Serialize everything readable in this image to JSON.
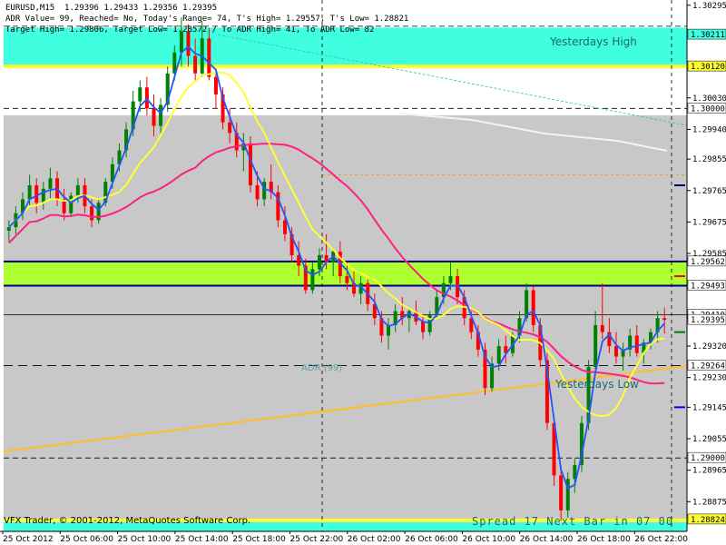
{
  "header": {
    "symbol_line": "EURUSD,M15  1.29396 1.29433 1.29356 1.29395",
    "adr_line": "ADR Value= 99, Reached= No, Today's Range= 74, T's High= 1.29557, T's Low= 1.28821",
    "target_line": "Target High= 1.29806, Target Low= 1.28572 / To ADR High= 41, To ADR Low= 82"
  },
  "footer": {
    "copyright": "VFX Trader, © 2001-2012, MetaQuotes Software Corp.",
    "spread": "Spread  17  Next Bar in 07 00"
  },
  "labels": {
    "yesterdays_high": "Yesterdays High",
    "yesterdays_low": "Yesterdays Low",
    "adr": "ADR (99)"
  },
  "colors": {
    "background": "#ffffff",
    "gray_zone": "#c8c8c8",
    "cyan_zone": "#40ffe0",
    "lime_zone": "#adff2f",
    "bull_candle": "#008000",
    "bear_candle": "#ff0000",
    "ma_blue": "#2255ff",
    "ma_yellow": "#ffff33",
    "ma_magenta": "#ff2080",
    "trend_orange": "#ffc020",
    "navy": "#000080"
  },
  "chart_data": {
    "type": "candlestick",
    "symbol": "EURUSD",
    "timeframe": "M15",
    "ylim": [
      1.2879,
      1.3031
    ],
    "x_ticks": [
      "25 Oct 2012",
      "25 Oct 06:00",
      "25 Oct 10:00",
      "25 Oct 14:00",
      "25 Oct 18:00",
      "25 Oct 22:00",
      "26 Oct 02:00",
      "26 Oct 06:00",
      "26 Oct 10:00",
      "26 Oct 14:00",
      "26 Oct 18:00",
      "26 Oct 22:00"
    ],
    "y_ticks": [
      1.30295,
      1.3003,
      1.2994,
      1.29855,
      1.29765,
      1.29675,
      1.29585,
      1.2932,
      1.2923,
      1.29145,
      1.29055,
      1.28965,
      1.28875
    ],
    "price_tags": [
      {
        "value": "1.30211",
        "level": 1.30211,
        "color": "#40ffe0"
      },
      {
        "value": "1.30120",
        "level": 1.3012,
        "color": "#ffff33"
      },
      {
        "value": "1.30000",
        "level": 1.3,
        "color": "#ffffff"
      },
      {
        "value": "1.29562",
        "level": 1.29562,
        "color": "#ffffff"
      },
      {
        "value": "1.29493",
        "level": 1.29493,
        "color": "#ffffff"
      },
      {
        "value": "1.29410",
        "level": 1.2941,
        "color": "#ffffff"
      },
      {
        "value": "1.29395",
        "level": 1.29395,
        "color": "#ffffff"
      },
      {
        "value": "1.29264",
        "level": 1.29264,
        "color": "#ffffff"
      },
      {
        "value": "1.29000",
        "level": 1.29,
        "color": "#ffffff"
      },
      {
        "value": "1.28824",
        "level": 1.28824,
        "color": "#ffff33"
      }
    ],
    "zones": {
      "cyan": [
        1.3012,
        1.30231
      ],
      "gray": [
        1.28824,
        1.2998
      ],
      "lime": [
        1.29493,
        1.29562
      ]
    },
    "ohlc_approx": [
      [
        1.2965,
        1.2968,
        1.2962,
        1.2966
      ],
      [
        1.2966,
        1.2972,
        1.2964,
        1.297
      ],
      [
        1.297,
        1.2976,
        1.2968,
        1.2974
      ],
      [
        1.2974,
        1.2981,
        1.2972,
        1.2978
      ],
      [
        1.2978,
        1.298,
        1.297,
        1.2973
      ],
      [
        1.2973,
        1.2979,
        1.2971,
        1.2977
      ],
      [
        1.2977,
        1.2983,
        1.2974,
        1.298
      ],
      [
        1.298,
        1.2982,
        1.2972,
        1.2974
      ],
      [
        1.2974,
        1.2977,
        1.2968,
        1.297
      ],
      [
        1.297,
        1.2976,
        1.2969,
        1.2975
      ],
      [
        1.2975,
        1.298,
        1.2973,
        1.2978
      ],
      [
        1.2978,
        1.298,
        1.297,
        1.2972
      ],
      [
        1.2972,
        1.2974,
        1.2966,
        1.2968
      ],
      [
        1.2968,
        1.2974,
        1.2967,
        1.2973
      ],
      [
        1.2973,
        1.298,
        1.2972,
        1.2979
      ],
      [
        1.2979,
        1.2986,
        1.2977,
        1.2984
      ],
      [
        1.2984,
        1.299,
        1.2982,
        1.2988
      ],
      [
        1.2988,
        1.2996,
        1.2986,
        1.2994
      ],
      [
        1.2994,
        1.3005,
        1.2992,
        1.3002
      ],
      [
        1.3002,
        1.3008,
        1.2999,
        1.3006
      ],
      [
        1.3006,
        1.3009,
        1.2998,
        1.3
      ],
      [
        1.3,
        1.3004,
        1.2992,
        1.2995
      ],
      [
        1.2995,
        1.3003,
        1.2993,
        1.3001
      ],
      [
        1.3001,
        1.3012,
        1.2999,
        1.301
      ],
      [
        1.301,
        1.3018,
        1.3008,
        1.3016
      ],
      [
        1.3016,
        1.3026,
        1.3012,
        1.3022
      ],
      [
        1.3022,
        1.3024,
        1.3012,
        1.3015
      ],
      [
        1.3015,
        1.302,
        1.3008,
        1.301
      ],
      [
        1.301,
        1.3025,
        1.3009,
        1.302
      ],
      [
        1.302,
        1.3023,
        1.3008,
        1.3009
      ],
      [
        1.3009,
        1.3011,
        1.3,
        1.3004
      ],
      [
        1.3004,
        1.3006,
        1.2994,
        1.2996
      ],
      [
        1.2996,
        1.3,
        1.299,
        1.2993
      ],
      [
        1.2993,
        1.2996,
        1.2986,
        1.2988
      ],
      [
        1.2988,
        1.2993,
        1.2982,
        1.299
      ],
      [
        1.299,
        1.2992,
        1.2976,
        1.2978
      ],
      [
        1.2978,
        1.2982,
        1.2972,
        1.2974
      ],
      [
        1.2974,
        1.298,
        1.2972,
        1.2979
      ],
      [
        1.2979,
        1.2984,
        1.2974,
        1.2976
      ],
      [
        1.2976,
        1.2978,
        1.2966,
        1.2968
      ],
      [
        1.2968,
        1.2972,
        1.2962,
        1.2964
      ],
      [
        1.2964,
        1.2966,
        1.2956,
        1.2958
      ],
      [
        1.2958,
        1.2962,
        1.2952,
        1.2955
      ],
      [
        1.2955,
        1.2957,
        1.2947,
        1.2948
      ],
      [
        1.2948,
        1.2956,
        1.2947,
        1.2954
      ],
      [
        1.2954,
        1.296,
        1.2952,
        1.2958
      ],
      [
        1.2958,
        1.2964,
        1.2954,
        1.2956
      ],
      [
        1.2956,
        1.296,
        1.2952,
        1.2959
      ],
      [
        1.2959,
        1.2962,
        1.295,
        1.2952
      ],
      [
        1.2952,
        1.2956,
        1.2948,
        1.295
      ],
      [
        1.295,
        1.2954,
        1.2946,
        1.2947
      ],
      [
        1.2947,
        1.2952,
        1.2944,
        1.295
      ],
      [
        1.295,
        1.2951,
        1.2942,
        1.2944
      ],
      [
        1.2944,
        1.2947,
        1.2938,
        1.294
      ],
      [
        1.294,
        1.2942,
        1.2933,
        1.2935
      ],
      [
        1.2935,
        1.294,
        1.2931,
        1.2938
      ],
      [
        1.2938,
        1.2944,
        1.2936,
        1.2942
      ],
      [
        1.2942,
        1.2946,
        1.2938,
        1.294
      ],
      [
        1.294,
        1.2943,
        1.2936,
        1.2942
      ],
      [
        1.2942,
        1.2945,
        1.2938,
        1.2939
      ],
      [
        1.2939,
        1.2941,
        1.2934,
        1.2936
      ],
      [
        1.2936,
        1.2942,
        1.2935,
        1.2941
      ],
      [
        1.2941,
        1.2948,
        1.294,
        1.2946
      ],
      [
        1.2946,
        1.2952,
        1.2944,
        1.295
      ],
      [
        1.295,
        1.2956,
        1.2948,
        1.2952
      ],
      [
        1.2952,
        1.2954,
        1.2944,
        1.2946
      ],
      [
        1.2946,
        1.2948,
        1.2938,
        1.294
      ],
      [
        1.294,
        1.2942,
        1.2934,
        1.2936
      ],
      [
        1.2936,
        1.2938,
        1.2929,
        1.2931
      ],
      [
        1.2931,
        1.2933,
        1.2918,
        1.292
      ],
      [
        1.292,
        1.2929,
        1.2919,
        1.2927
      ],
      [
        1.2927,
        1.2934,
        1.2925,
        1.2932
      ],
      [
        1.2932,
        1.2935,
        1.2927,
        1.293
      ],
      [
        1.293,
        1.2936,
        1.2929,
        1.2935
      ],
      [
        1.2935,
        1.2942,
        1.2933,
        1.294
      ],
      [
        1.294,
        1.295,
        1.2939,
        1.2948
      ],
      [
        1.2948,
        1.2949,
        1.2936,
        1.2938
      ],
      [
        1.2938,
        1.294,
        1.2926,
        1.2928
      ],
      [
        1.2928,
        1.293,
        1.2908,
        1.291
      ],
      [
        1.291,
        1.2912,
        1.2892,
        1.2895
      ],
      [
        1.2895,
        1.2898,
        1.2882,
        1.2885
      ],
      [
        1.2885,
        1.2896,
        1.2883,
        1.2894
      ],
      [
        1.2894,
        1.29,
        1.289,
        1.2898
      ],
      [
        1.2898,
        1.2912,
        1.2896,
        1.291
      ],
      [
        1.291,
        1.2928,
        1.2908,
        1.2926
      ],
      [
        1.2926,
        1.2942,
        1.2924,
        1.2938
      ],
      [
        1.2938,
        1.295,
        1.2934,
        1.2936
      ],
      [
        1.2936,
        1.294,
        1.293,
        1.2932
      ],
      [
        1.2932,
        1.2936,
        1.2927,
        1.2929
      ],
      [
        1.2929,
        1.2933,
        1.2925,
        1.2931
      ],
      [
        1.2931,
        1.2937,
        1.2929,
        1.2935
      ],
      [
        1.2935,
        1.2938,
        1.2929,
        1.293
      ],
      [
        1.293,
        1.2934,
        1.2927,
        1.2933
      ],
      [
        1.2933,
        1.2937,
        1.2931,
        1.2936
      ],
      [
        1.2936,
        1.2942,
        1.2933,
        1.294
      ],
      [
        1.294,
        1.2943,
        1.29356,
        1.29395
      ]
    ]
  }
}
